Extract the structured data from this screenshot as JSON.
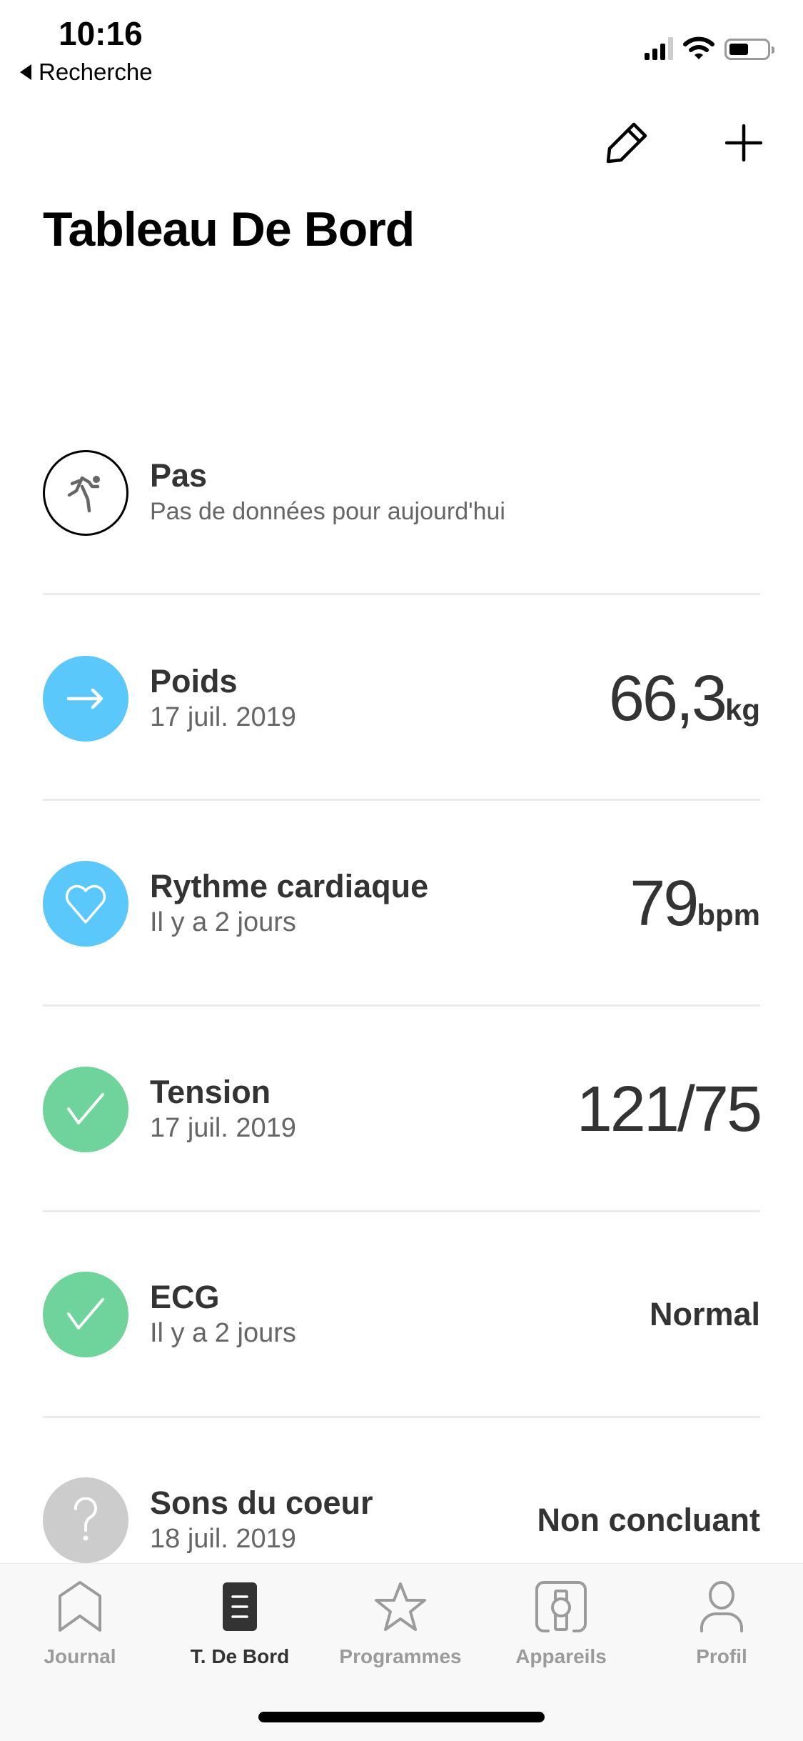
{
  "status_bar": {
    "time": "10:16",
    "back_label": "Recherche",
    "signal_bars": 3,
    "signal_bars_total": 4,
    "battery_level": 0.45
  },
  "header": {
    "edit_icon": "pencil-icon",
    "add_icon": "plus-icon",
    "title": "Tableau De Bord"
  },
  "colors": {
    "blue": "#5ac8fa",
    "green": "#6fd49c",
    "gray": "#cccccc",
    "text": "#333333",
    "subtext": "#666666",
    "tab_inactive": "#9b9b9b"
  },
  "metrics": [
    {
      "label": "Pas",
      "subtitle": "Pas de données pour aujourd'hui",
      "icon": "runner-icon",
      "value": "",
      "unit": ""
    },
    {
      "label": "Poids",
      "subtitle": "17 juil. 2019",
      "icon": "arrow-right-icon",
      "value": "66,3",
      "unit": "kg"
    },
    {
      "label": "Rythme cardiaque",
      "subtitle": "Il y a 2 jours",
      "icon": "heart-icon",
      "value": "79",
      "unit": "bpm"
    },
    {
      "label": "Tension",
      "subtitle": "17 juil. 2019",
      "icon": "checkmark-icon",
      "value": "121/75",
      "unit": ""
    },
    {
      "label": "ECG",
      "subtitle": "Il y a 2 jours",
      "icon": "checkmark-icon",
      "value": "Normal",
      "unit": ""
    },
    {
      "label": "Sons du coeur",
      "subtitle": "18 juil. 2019",
      "icon": "question-icon",
      "value": "Non concluant",
      "unit": ""
    }
  ],
  "tabs": [
    {
      "label": "Journal",
      "icon": "journal-icon",
      "active": false
    },
    {
      "label": "T. De Bord",
      "icon": "dashboard-icon",
      "active": true
    },
    {
      "label": "Programmes",
      "icon": "star-icon",
      "active": false
    },
    {
      "label": "Appareils",
      "icon": "watch-icon",
      "active": false
    },
    {
      "label": "Profil",
      "icon": "person-icon",
      "active": false
    }
  ]
}
